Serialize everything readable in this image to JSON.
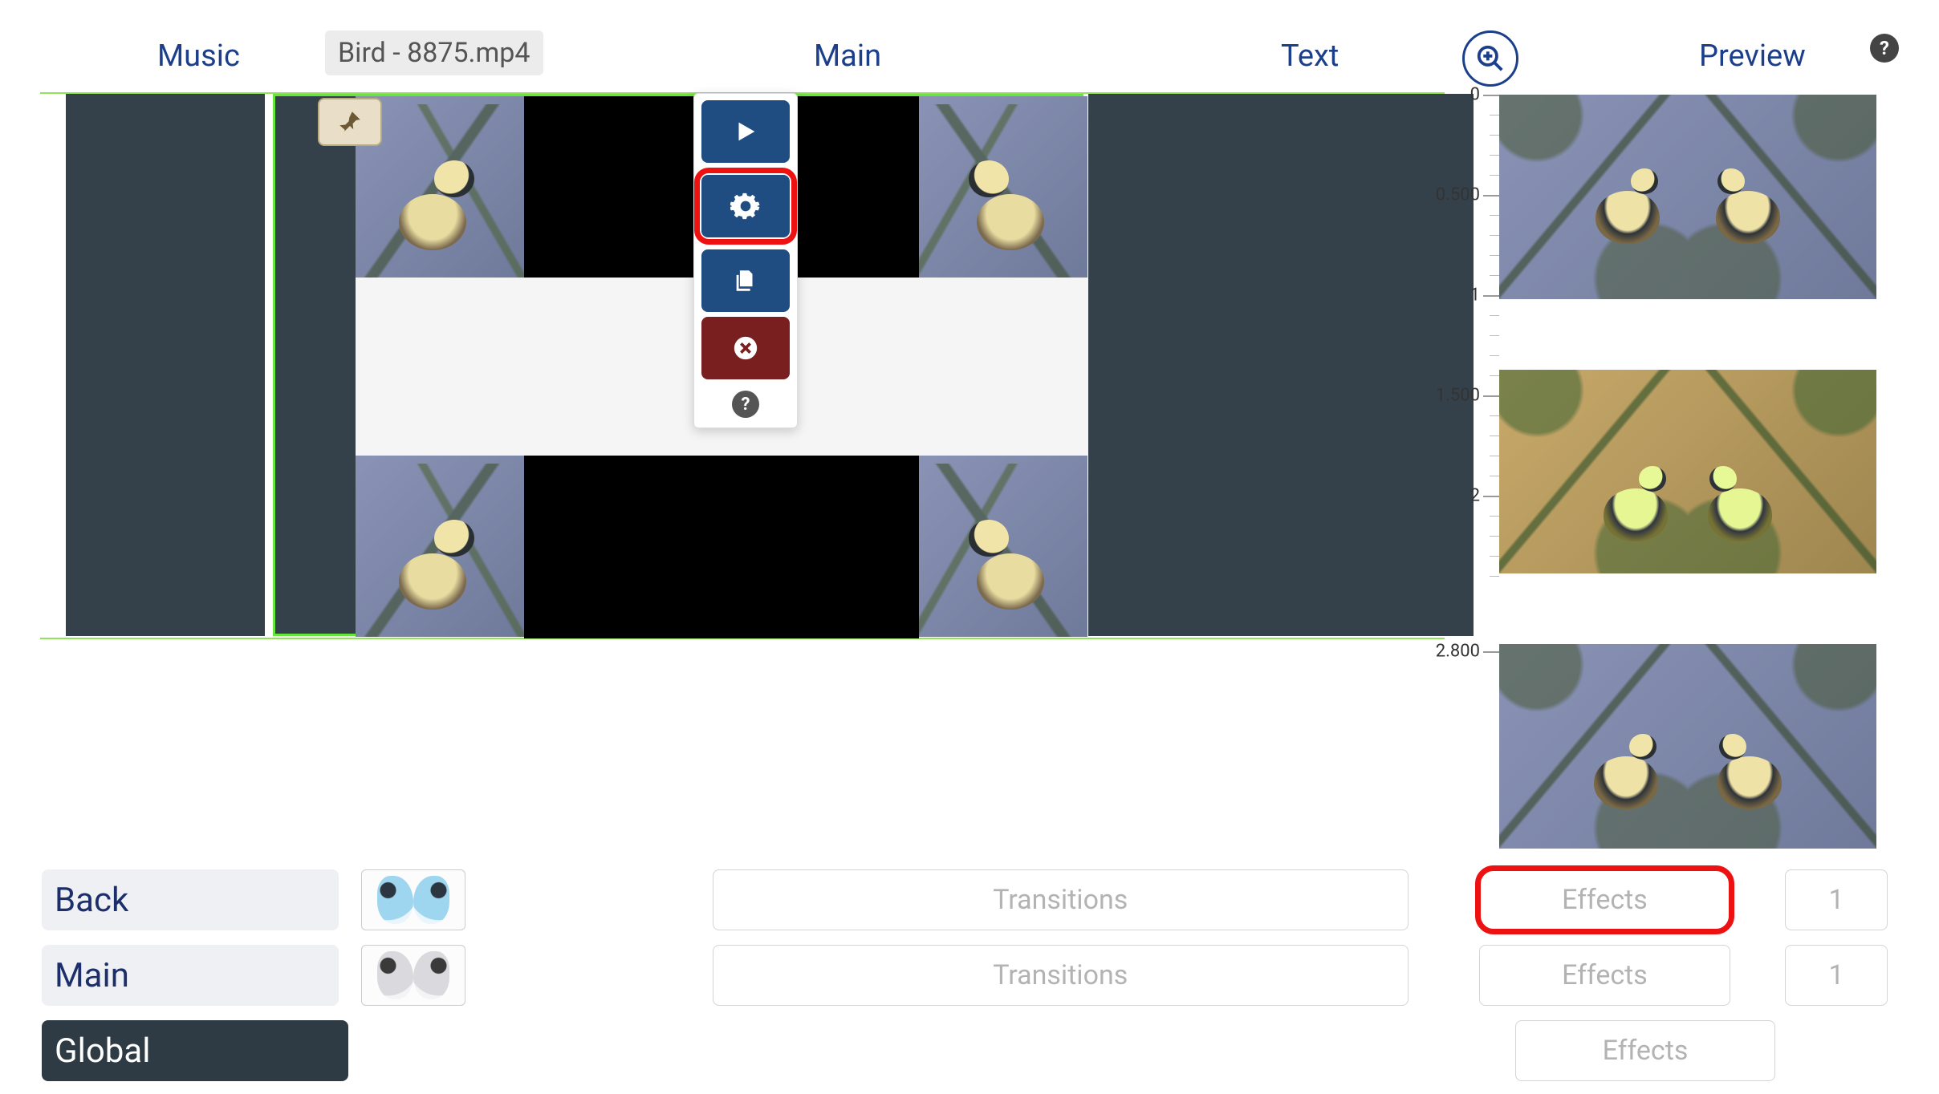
{
  "tabs": {
    "music": "Music",
    "main": "Main",
    "text": "Text",
    "preview": "Preview"
  },
  "clip": {
    "filename": "Bird - 8875.mp4"
  },
  "ruler": {
    "labels": [
      "0",
      "0.500",
      "1",
      "1.500",
      "2",
      "2.800"
    ]
  },
  "actions": {
    "play": "play",
    "settings": "settings",
    "copy": "copy",
    "delete": "delete",
    "help": "?"
  },
  "layers": [
    {
      "name": "Back",
      "transitions": "Transitions",
      "effects": "Effects",
      "count": "1"
    },
    {
      "name": "Main",
      "transitions": "Transitions",
      "effects": "Effects",
      "count": "1"
    },
    {
      "name": "Global",
      "effects": "Effects"
    }
  ],
  "help_glyph": "?"
}
